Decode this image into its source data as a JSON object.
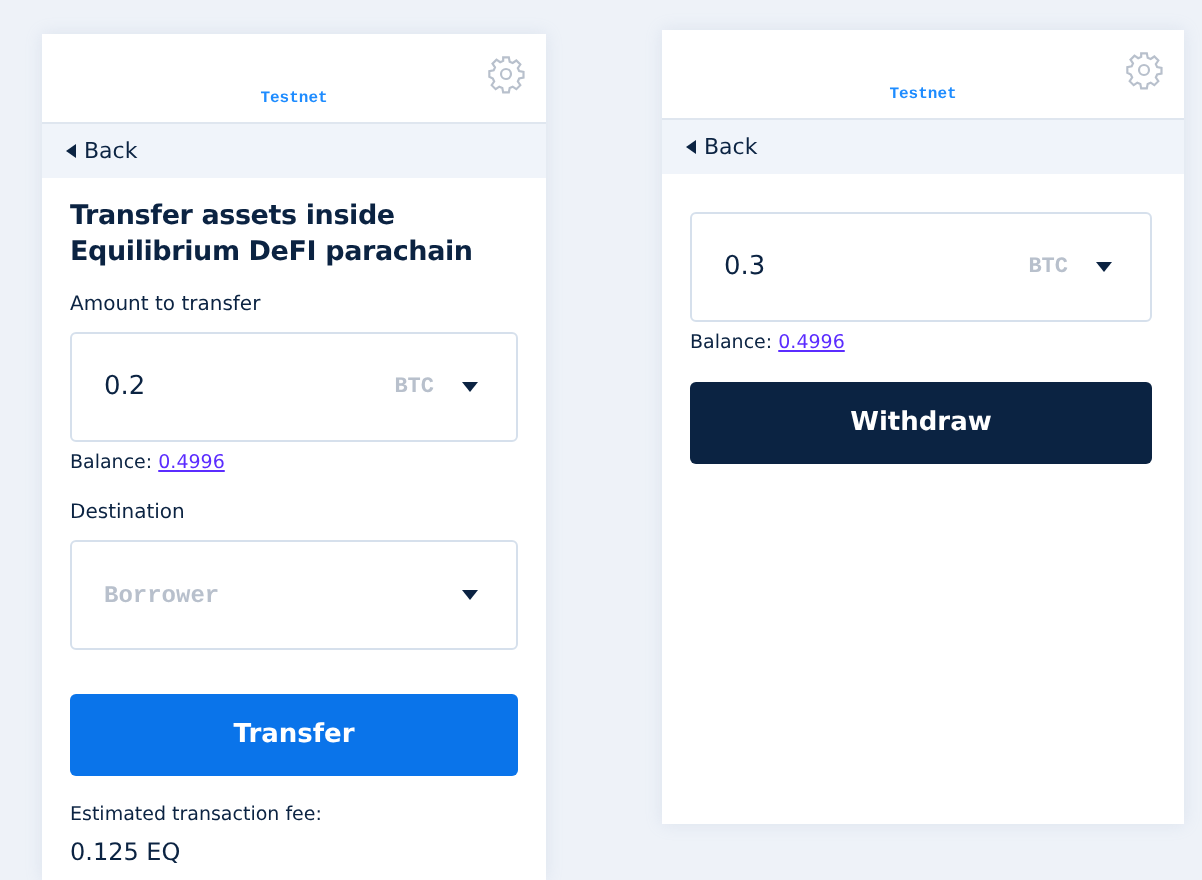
{
  "transfer_panel": {
    "network": "Testnet",
    "back": "Back",
    "title": "Transfer assets inside Equilibrium DeFI parachain",
    "amount_label": "Amount to transfer",
    "amount": {
      "value": "0.2",
      "currency": "BTC"
    },
    "balance_label": "Balance:",
    "balance": "0.4996",
    "destination_label": "Destination",
    "destination": {
      "placeholder": "Borrower"
    },
    "button": "Transfer",
    "fee_label": "Estimated transaction fee:",
    "fee": "0.125 EQ"
  },
  "withdraw_panel": {
    "network": "Testnet",
    "back": "Back",
    "amount": {
      "value": "0.3",
      "currency": "BTC"
    },
    "balance_label": "Balance:",
    "balance": "0.4996",
    "button": "Withdraw"
  }
}
